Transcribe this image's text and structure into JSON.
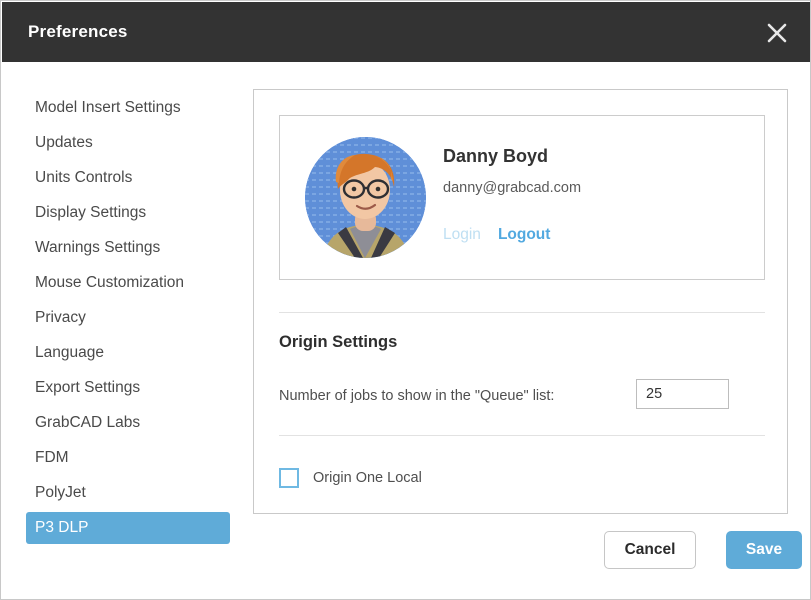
{
  "window": {
    "title": "Preferences",
    "close_icon": "close-x-icon"
  },
  "sidebar": {
    "items": [
      {
        "label": "Model Insert Settings",
        "selected": false
      },
      {
        "label": "Updates",
        "selected": false
      },
      {
        "label": "Units Controls",
        "selected": false
      },
      {
        "label": "Display Settings",
        "selected": false
      },
      {
        "label": "Warnings Settings",
        "selected": false
      },
      {
        "label": "Mouse Customization",
        "selected": false
      },
      {
        "label": "Privacy",
        "selected": false
      },
      {
        "label": "Language",
        "selected": false
      },
      {
        "label": "Export Settings",
        "selected": false
      },
      {
        "label": "GrabCAD Labs",
        "selected": false
      },
      {
        "label": "FDM",
        "selected": false
      },
      {
        "label": "PolyJet",
        "selected": false
      },
      {
        "label": "P3 DLP",
        "selected": true
      }
    ]
  },
  "profile": {
    "name": "Danny Boyd",
    "email": "danny@grabcad.com",
    "login_label": "Login",
    "logout_label": "Logout",
    "avatar_icon": "user-avatar-photo"
  },
  "origin_settings": {
    "section_title": "Origin Settings",
    "jobs_label": "Number of jobs to show in the \"Queue\" list:",
    "jobs_value": "25",
    "jobs_placeholder": "",
    "origin_one_local_label": "Origin One Local",
    "origin_one_local_checked": false
  },
  "footer": {
    "cancel_label": "Cancel",
    "save_label": "Save"
  },
  "colors": {
    "titlebar_bg": "#333333",
    "accent": "#5fabd8",
    "link_active": "#52a9e0",
    "link_disabled": "#bfdff2",
    "checkbox_border": "#6fb9e3",
    "panel_border": "#c9c9c9",
    "divider": "#e2e2e2"
  }
}
